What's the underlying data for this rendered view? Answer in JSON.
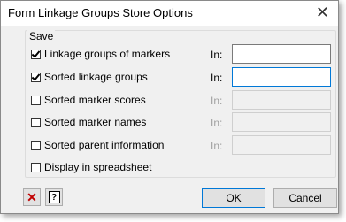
{
  "window": {
    "title": "Form Linkage Groups Store Options",
    "close_glyph": "✕"
  },
  "group": {
    "label": "Save"
  },
  "options": [
    {
      "label": "Linkage groups of markers",
      "checked": true,
      "in_label": "In:",
      "value": ""
    },
    {
      "label": "Sorted linkage groups",
      "checked": true,
      "in_label": "In:",
      "value": ""
    },
    {
      "label": "Sorted marker scores",
      "checked": false,
      "in_label": "In:",
      "value": ""
    },
    {
      "label": "Sorted marker names",
      "checked": false,
      "in_label": "In:",
      "value": ""
    },
    {
      "label": "Sorted parent information",
      "checked": false,
      "in_label": "In:",
      "value": ""
    },
    {
      "label": "Display in spreadsheet",
      "checked": false
    }
  ],
  "buttons": {
    "ok": "OK",
    "cancel": "Cancel",
    "clear_glyph": "✕",
    "help_glyph": "?"
  },
  "colors": {
    "clear_icon": "#c00000",
    "focus": "#0078d7"
  }
}
